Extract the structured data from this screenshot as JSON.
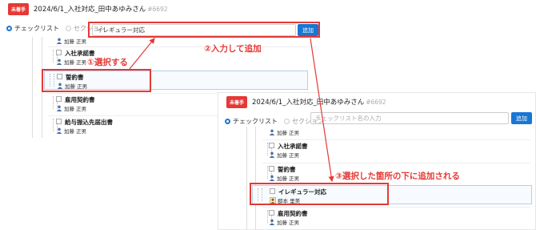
{
  "before": {
    "badge": "未着手",
    "title": "2024/6/1_入社対応_田中あゆみさん",
    "id": "#6692",
    "radio_checklist": "チェックリスト",
    "radio_section": "セクション",
    "input_value": "イレギュラー対応",
    "add_label": "追加",
    "items": [
      {
        "title": "入社承諾書",
        "assignee": "加藤 正男"
      },
      {
        "title": "誓約書",
        "assignee": "加藤 正男"
      },
      {
        "title": "雇用契約書",
        "assignee": "加藤 正男"
      },
      {
        "title": "給与振込先届出書",
        "assignee": "加藤 正男"
      }
    ]
  },
  "after": {
    "badge": "未着手",
    "title": "2024/6/1_入社対応_田中あゆみさん",
    "id": "#6692",
    "radio_checklist": "チェックリスト",
    "radio_section": "セクション",
    "input_placeholder": "チェックリスト名の入力",
    "add_label": "追加",
    "top_assignee": "加藤 正男",
    "items": [
      {
        "title": "入社承諾書",
        "assignee": "加藤 正男"
      },
      {
        "title": "誓約書",
        "assignee": "加藤 正男"
      },
      {
        "title": "イレギュラー対応",
        "assignee": "郡本 里美"
      },
      {
        "title": "雇用契約書",
        "assignee": "加藤 正男"
      }
    ]
  },
  "annotations": {
    "step1": "①選択する",
    "step2": "②入力して追加",
    "step3": "③選択した箇所の下に追加される",
    "accent_color": "#e53935"
  }
}
